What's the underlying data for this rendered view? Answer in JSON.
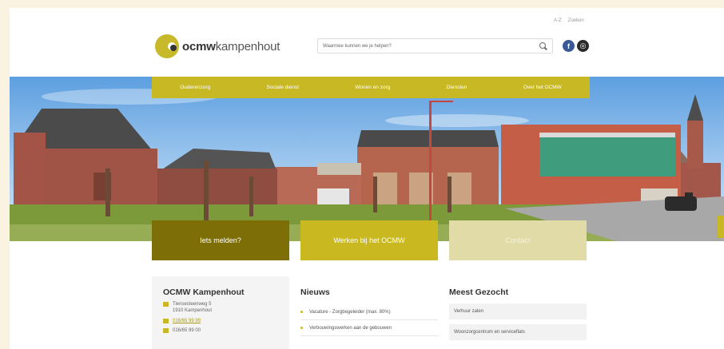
{
  "header": {
    "util_links": [
      "A-Z",
      "Zoeken"
    ],
    "logo_bold": "ocmw",
    "logo_rest": "kampenhout",
    "search_placeholder": "Waarmee kunnen we je helpen?",
    "social": [
      "f",
      "◎"
    ]
  },
  "nav": {
    "items": [
      "Ouderenzorg",
      "Sociale dienst",
      "Wonen en zorg",
      "Diensten",
      "Over het OCMW"
    ]
  },
  "tiles": [
    "Iets melden?",
    "Werken bij het OCMW",
    "Contact"
  ],
  "contact": {
    "title": "OCMW Kampenhout",
    "address_line1": "Tiensesteenweg 5",
    "address_line2": "1910 Kampenhout",
    "phone": "016/65 99 99",
    "extra": "016/65 99 00"
  },
  "news": {
    "title": "Nieuws",
    "items": [
      "Vacature - Zorgbegeleider (max. 80%)",
      "Verbouwingswerken aan de gebouwen"
    ]
  },
  "most_searched": {
    "title": "Meest Gezocht",
    "items": [
      "Verhuur zalen",
      "Woonzorgcentrum en serviceflats"
    ]
  },
  "colors": {
    "brand": "#c8b823",
    "brand_dark": "#7e6e07",
    "brand_light": "#e1dba7",
    "outer_bg": "#fbf3e2"
  },
  "icons": [
    "search-icon",
    "facebook-icon",
    "instagram-icon",
    "location-icon",
    "phone-icon",
    "email-icon"
  ]
}
